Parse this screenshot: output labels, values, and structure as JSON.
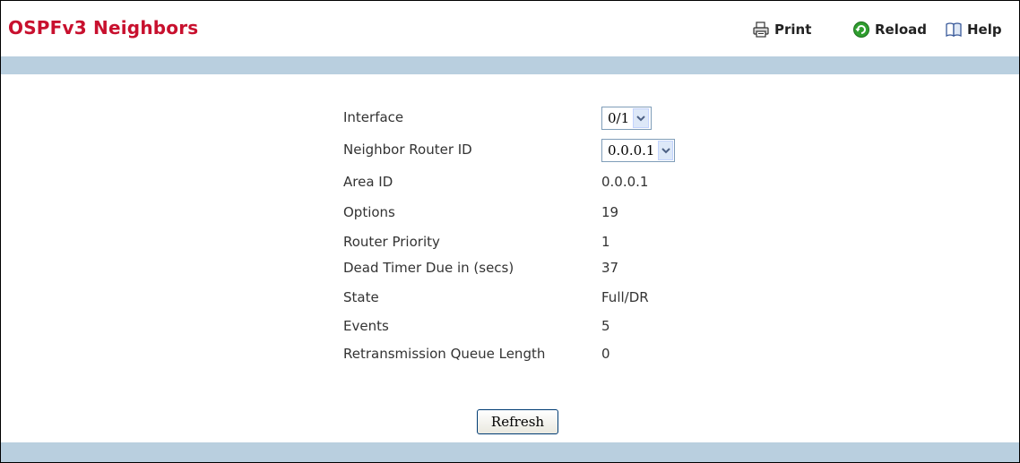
{
  "page": {
    "title": "OSPFv3 Neighbors"
  },
  "toolbar": {
    "print_label": "Print",
    "reload_label": "Reload",
    "help_label": "Help"
  },
  "form": {
    "interface": {
      "label": "Interface",
      "selected": "0/1"
    },
    "neighbor_router_id": {
      "label": "Neighbor Router ID",
      "selected": "0.0.0.1"
    },
    "area_id": {
      "label": "Area ID",
      "value": "0.0.0.1"
    },
    "options": {
      "label": "Options",
      "value": "19"
    },
    "router_priority": {
      "label": "Router Priority",
      "value": "1"
    },
    "dead_timer": {
      "label": "Dead Timer Due in (secs)",
      "value": "37"
    },
    "state": {
      "label": "State",
      "value": "Full/DR"
    },
    "events": {
      "label": "Events",
      "value": "5"
    },
    "retransmission_queue_length": {
      "label": "Retransmission Queue Length",
      "value": "0"
    }
  },
  "actions": {
    "refresh_label": "Refresh"
  },
  "colors": {
    "title": "#c8102e",
    "band": "#b9cfdf",
    "text": "#333333"
  },
  "icons": {
    "print": "printer-icon",
    "reload": "reload-icon",
    "help": "help-book-icon",
    "dropdown": "chevron-down-icon"
  }
}
